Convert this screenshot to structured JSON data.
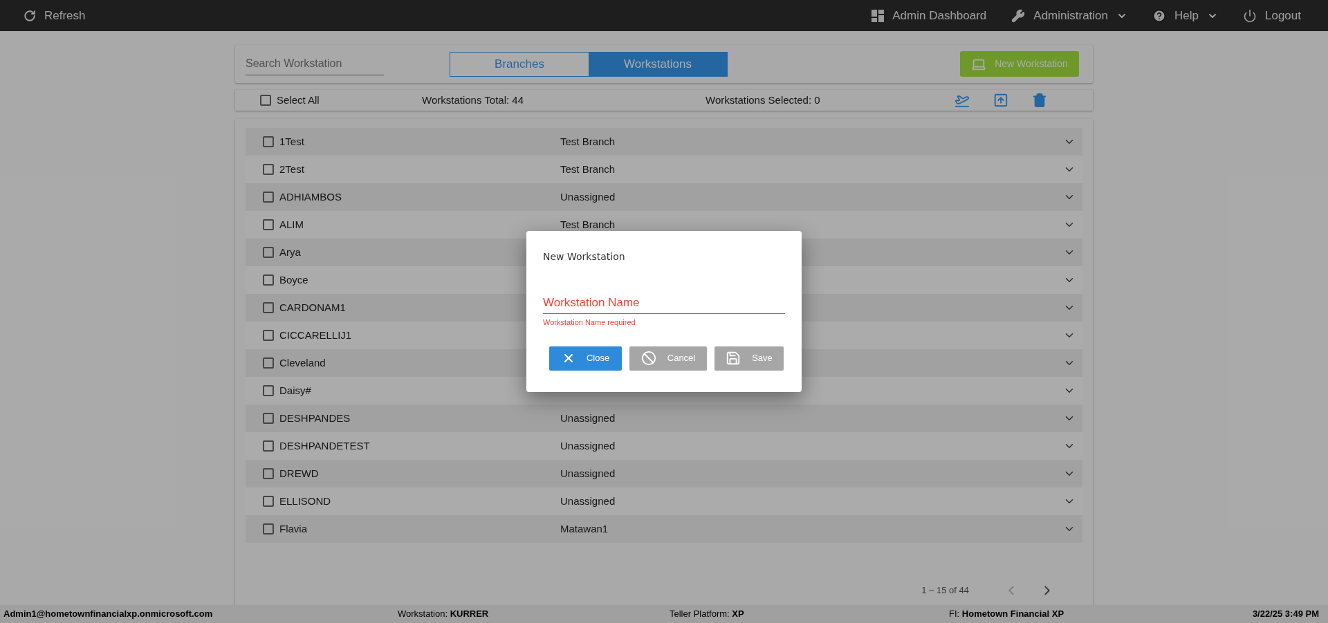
{
  "topbar": {
    "refresh": "Refresh",
    "menu": [
      {
        "label": "Admin Dashboard",
        "kind": "link"
      },
      {
        "label": "Administration",
        "kind": "dropdown"
      },
      {
        "label": "Help",
        "kind": "dropdown"
      },
      {
        "label": "Logout",
        "kind": "link"
      }
    ]
  },
  "search": {
    "placeholder": "Search Workstation"
  },
  "tabs": [
    {
      "label": "Branches",
      "selected": false
    },
    {
      "label": "Workstations",
      "selected": true
    }
  ],
  "new_button": "New Workstation",
  "summary": {
    "select_all": {
      "label": "Select All",
      "checked": false
    },
    "total": "Workstations Total: 44",
    "selected_count": "Workstations Selected: 0"
  },
  "rows": [
    {
      "name": "1Test",
      "branch": "Test Branch",
      "checked": false
    },
    {
      "name": "2Test",
      "branch": "Test Branch",
      "checked": false
    },
    {
      "name": "ADHIAMBOS",
      "branch": "Unassigned",
      "checked": false
    },
    {
      "name": "ALIM",
      "branch": "Test Branch",
      "checked": false
    },
    {
      "name": "Arya",
      "checked": false
    },
    {
      "name": "Boyce",
      "checked": false
    },
    {
      "name": "CARDONAM1",
      "checked": false
    },
    {
      "name": "CICCARELLIJ1",
      "checked": false
    },
    {
      "name": "Cleveland",
      "checked": false
    },
    {
      "name": "Daisy#",
      "checked": false
    },
    {
      "name": "DESHPANDES",
      "branch": "Unassigned",
      "checked": false
    },
    {
      "name": "DESHPANDETEST",
      "branch": "Unassigned",
      "checked": false
    },
    {
      "name": "DREWD",
      "branch": "Unassigned",
      "checked": false
    },
    {
      "name": "ELLISOND",
      "branch": "Unassigned",
      "checked": false
    },
    {
      "name": "Flavia",
      "branch": "Matawan1",
      "checked": false
    }
  ],
  "pagination": {
    "range": "1 – 15 of 44",
    "prev_disabled": true,
    "next_disabled": false
  },
  "dialog": {
    "title": "New Workstation",
    "field": {
      "placeholder": "Workstation Name",
      "error": "Workstation Name required"
    },
    "buttons": [
      {
        "label": "Close",
        "kind": "close",
        "disabled": false
      },
      {
        "label": "Cancel",
        "kind": "cancel",
        "disabled": true
      },
      {
        "label": "Save",
        "kind": "save",
        "disabled": true
      }
    ]
  },
  "status_bar": {
    "user": "Admin1@hometownfinancialxp.onmicrosoft.com",
    "items": [
      {
        "label": "Workstation:",
        "value": "KURRER"
      },
      {
        "label": "Teller Platform:",
        "value": "XP"
      },
      {
        "label": "FI:",
        "value": "Hometown Financial XP"
      }
    ],
    "datetime": "3/22/25 3:49 PM"
  }
}
